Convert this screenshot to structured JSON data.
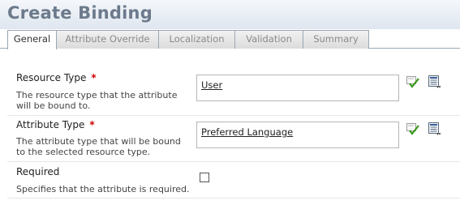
{
  "header": {
    "title": "Create Binding"
  },
  "tabs": [
    {
      "label": "General",
      "active": true
    },
    {
      "label": "Attribute Override",
      "active": false
    },
    {
      "label": "Localization",
      "active": false
    },
    {
      "label": "Validation",
      "active": false
    },
    {
      "label": "Summary",
      "active": false
    }
  ],
  "fields": {
    "resource_type": {
      "label": "Resource Type",
      "required_mark": "*",
      "description": "The resource type that the attribute will be bound to.",
      "value": "User",
      "icons": [
        "validate-check-icon",
        "browse-list-icon"
      ]
    },
    "attribute_type": {
      "label": "Attribute Type",
      "required_mark": "*",
      "description": "The attribute type that will be bound to the selected resource type.",
      "value": "Preferred Language",
      "icons": [
        "validate-check-icon",
        "browse-list-icon"
      ]
    },
    "required": {
      "label": "Required",
      "description": "Specifies that the attribute is required.",
      "checked": false
    }
  },
  "colors": {
    "required_mark": "#d00000",
    "check_green": "#3a9a1e",
    "title": "#6c7a8c"
  }
}
